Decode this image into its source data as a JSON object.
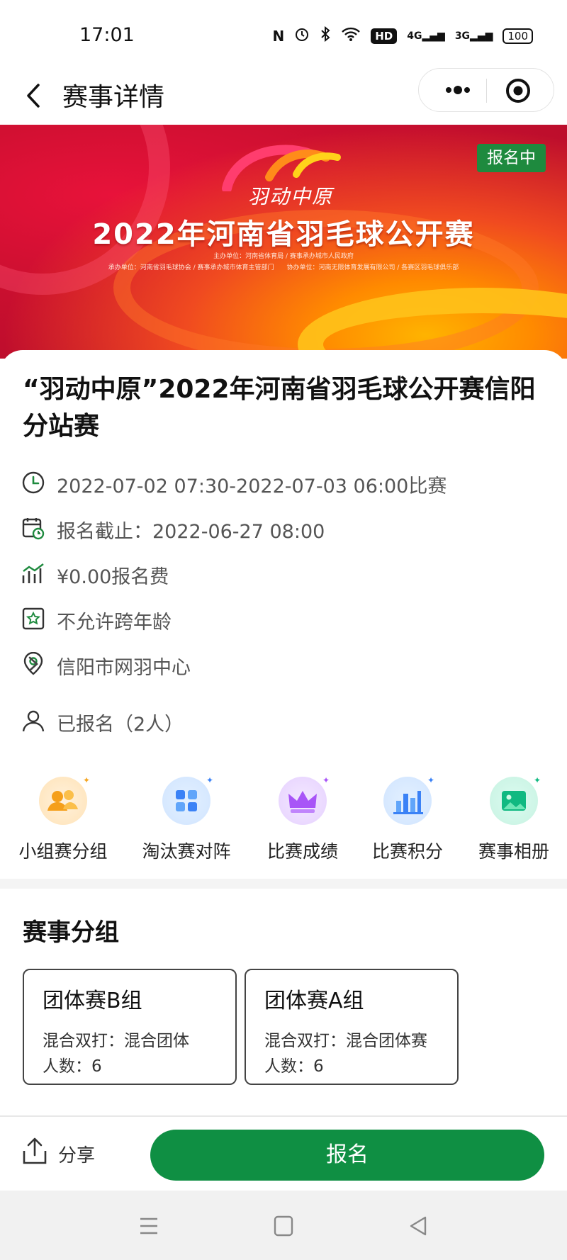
{
  "status_bar": {
    "time": "17:01",
    "nfc_icon": "N",
    "hd_label": "HD",
    "sim1_label": "4G",
    "sim2_label": "3G",
    "battery_label": "100"
  },
  "nav": {
    "title": "赛事详情"
  },
  "banner": {
    "logo_text": "羽动中原",
    "title": "2022年河南省羽毛球公开赛",
    "sub_line1": "主办单位：河南省体育局 / 赛事承办城市人民政府",
    "sub_line2": "承办单位：河南省羽毛球协会 / 赛事承办城市体育主管部门　　协办单位：河南无限体育发展有限公司 / 各赛区羽毛球俱乐部",
    "status_tag": "报名中"
  },
  "event": {
    "title": "“羽动中原”2022年河南省羽毛球公开赛信阳分站赛",
    "time": "2022-07-02 07:30-2022-07-03 06:00比赛",
    "deadline": "报名截止：2022-06-27 08:00",
    "fee": "¥0.00报名费",
    "age_rule": "不允许跨年龄",
    "venue": "信阳市网羽中心",
    "registered": "已报名（2人）"
  },
  "functions": [
    {
      "label": "小组赛分组",
      "icon": "group-people-icon",
      "color": "#f5a623"
    },
    {
      "label": "淘汰赛对阵",
      "icon": "bracket-grid-icon",
      "color": "#3b82f6"
    },
    {
      "label": "比赛成绩",
      "icon": "crown-icon",
      "color": "#a855f7"
    },
    {
      "label": "比赛积分",
      "icon": "bar-chart-icon",
      "color": "#3b82f6"
    },
    {
      "label": "赛事相册",
      "icon": "photo-album-icon",
      "color": "#10b981"
    }
  ],
  "groups_section": {
    "title": "赛事分组",
    "groups": [
      {
        "name": "团体赛B组",
        "type_line": "混合双打：混合团体",
        "count_line": "人数：6"
      },
      {
        "name": "团体赛A组",
        "type_line": "混合双打：混合团体赛",
        "count_line": "人数：6"
      }
    ]
  },
  "bottom": {
    "share_label": "分享",
    "signup_label": "报名"
  },
  "colors": {
    "primary_green": "#0f8f43",
    "status_tag_green": "#1e8a3e",
    "banner_red": "#c90f2f"
  }
}
